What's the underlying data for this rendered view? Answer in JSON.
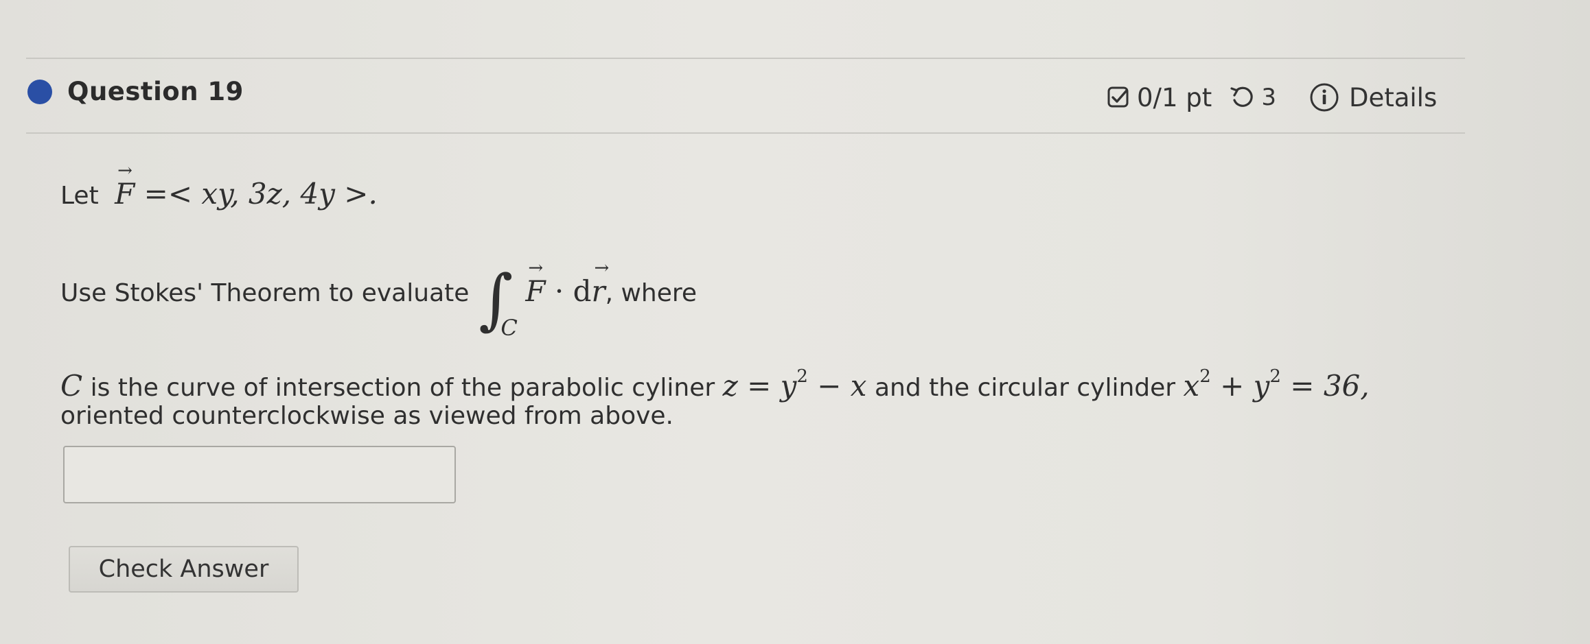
{
  "question": {
    "title": "Question 19",
    "points": "0/1 pt",
    "attempts": "3",
    "details_label": "Details"
  },
  "problem": {
    "line1_prefix": "Let",
    "line1_F": "F",
    "line1_expr": "=< xy, 3z, 4y >.",
    "line2_prefix": "Use Stokes' Theorem to evaluate",
    "integral_symbol": "∫",
    "integral_sub": "C",
    "integrand_F": "F",
    "integrand_dot": " · d",
    "integrand_r": "r",
    "line2_suffix": ", where",
    "line3_C": "C",
    "line3_text1": " is the curve of intersection of the parabolic cyliner ",
    "line3_eq1_a": "z = y",
    "line3_eq1_exp": "2",
    "line3_eq1_b": " − x",
    "line3_text2": " and the circular cylinder ",
    "line3_eq2_a": "x",
    "line3_eq2_exp1": "2",
    "line3_eq2_b": " + y",
    "line3_eq2_exp2": "2",
    "line3_eq2_c": " = 36,",
    "line4": "oriented counterclockwise as viewed from above."
  },
  "answer": {
    "value": "",
    "placeholder": ""
  },
  "check_button_label": "Check Answer",
  "colors": {
    "status_dot": "#2a4fa5",
    "background": "#e4e3de"
  },
  "icons": {
    "points": "checkbox-icon",
    "attempts": "retry-icon",
    "details": "info-icon"
  }
}
